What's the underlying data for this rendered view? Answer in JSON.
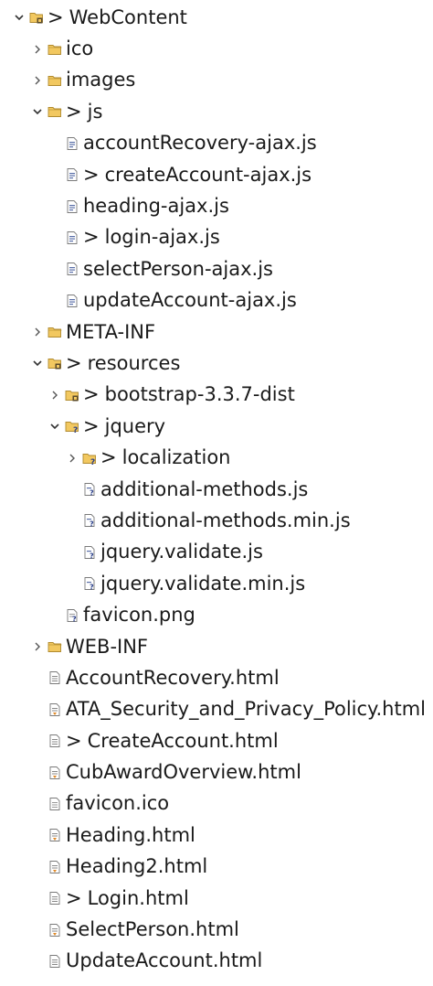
{
  "explorer": {
    "items": [
      {
        "label": "WebContent",
        "kind": "folder-project",
        "level": 0,
        "expanded": true,
        "dirty": true
      },
      {
        "label": "ico",
        "kind": "folder",
        "level": 1,
        "expanded": false,
        "dirty": false
      },
      {
        "label": "images",
        "kind": "folder",
        "level": 1,
        "expanded": false,
        "dirty": false
      },
      {
        "label": "js",
        "kind": "folder",
        "level": 1,
        "expanded": true,
        "dirty": true
      },
      {
        "label": "accountRecovery-ajax.js",
        "kind": "js-file",
        "level": 2,
        "dirty": false
      },
      {
        "label": "createAccount-ajax.js",
        "kind": "js-file",
        "level": 2,
        "dirty": true
      },
      {
        "label": "heading-ajax.js",
        "kind": "js-file",
        "level": 2,
        "dirty": false
      },
      {
        "label": "login-ajax.js",
        "kind": "js-file",
        "level": 2,
        "dirty": true
      },
      {
        "label": "selectPerson-ajax.js",
        "kind": "js-file",
        "level": 2,
        "dirty": false
      },
      {
        "label": "updateAccount-ajax.js",
        "kind": "js-file",
        "level": 2,
        "dirty": false
      },
      {
        "label": "META-INF",
        "kind": "folder",
        "level": 1,
        "expanded": false,
        "dirty": false
      },
      {
        "label": "resources",
        "kind": "folder-project",
        "level": 1,
        "expanded": true,
        "dirty": true
      },
      {
        "label": "bootstrap-3.3.7-dist",
        "kind": "folder-project",
        "level": 2,
        "expanded": false,
        "dirty": true
      },
      {
        "label": "jquery",
        "kind": "folder-untracked",
        "level": 2,
        "expanded": true,
        "dirty": true
      },
      {
        "label": "localization",
        "kind": "folder-untracked",
        "level": 3,
        "expanded": false,
        "dirty": true
      },
      {
        "label": "additional-methods.js",
        "kind": "js-untracked",
        "level": 3,
        "dirty": false
      },
      {
        "label": "additional-methods.min.js",
        "kind": "js-untracked",
        "level": 3,
        "dirty": false
      },
      {
        "label": "jquery.validate.js",
        "kind": "js-untracked",
        "level": 3,
        "dirty": false
      },
      {
        "label": "jquery.validate.min.js",
        "kind": "js-untracked",
        "level": 3,
        "dirty": false
      },
      {
        "label": "favicon.png",
        "kind": "file-untracked",
        "level": 2,
        "dirty": false
      },
      {
        "label": "WEB-INF",
        "kind": "folder",
        "level": 1,
        "expanded": false,
        "dirty": false
      },
      {
        "label": "AccountRecovery.html",
        "kind": "html-file",
        "level": 1,
        "dirty": false
      },
      {
        "label": "ATA_Security_and_Privacy_Policy.html",
        "kind": "html-file-orange",
        "level": 1,
        "dirty": false
      },
      {
        "label": "CreateAccount.html",
        "kind": "html-file",
        "level": 1,
        "dirty": true
      },
      {
        "label": "CubAwardOverview.html",
        "kind": "html-file-orange",
        "level": 1,
        "dirty": false
      },
      {
        "label": "favicon.ico",
        "kind": "file",
        "level": 1,
        "dirty": false
      },
      {
        "label": "Heading.html",
        "kind": "html-file-orange",
        "level": 1,
        "dirty": false
      },
      {
        "label": "Heading2.html",
        "kind": "html-file-orange",
        "level": 1,
        "dirty": false
      },
      {
        "label": "Login.html",
        "kind": "html-file",
        "level": 1,
        "dirty": true
      },
      {
        "label": "SelectPerson.html",
        "kind": "html-file-orange",
        "level": 1,
        "dirty": false
      },
      {
        "label": "UpdateAccount.html",
        "kind": "html-file",
        "level": 1,
        "dirty": false
      }
    ],
    "dirty_marker": ">"
  }
}
